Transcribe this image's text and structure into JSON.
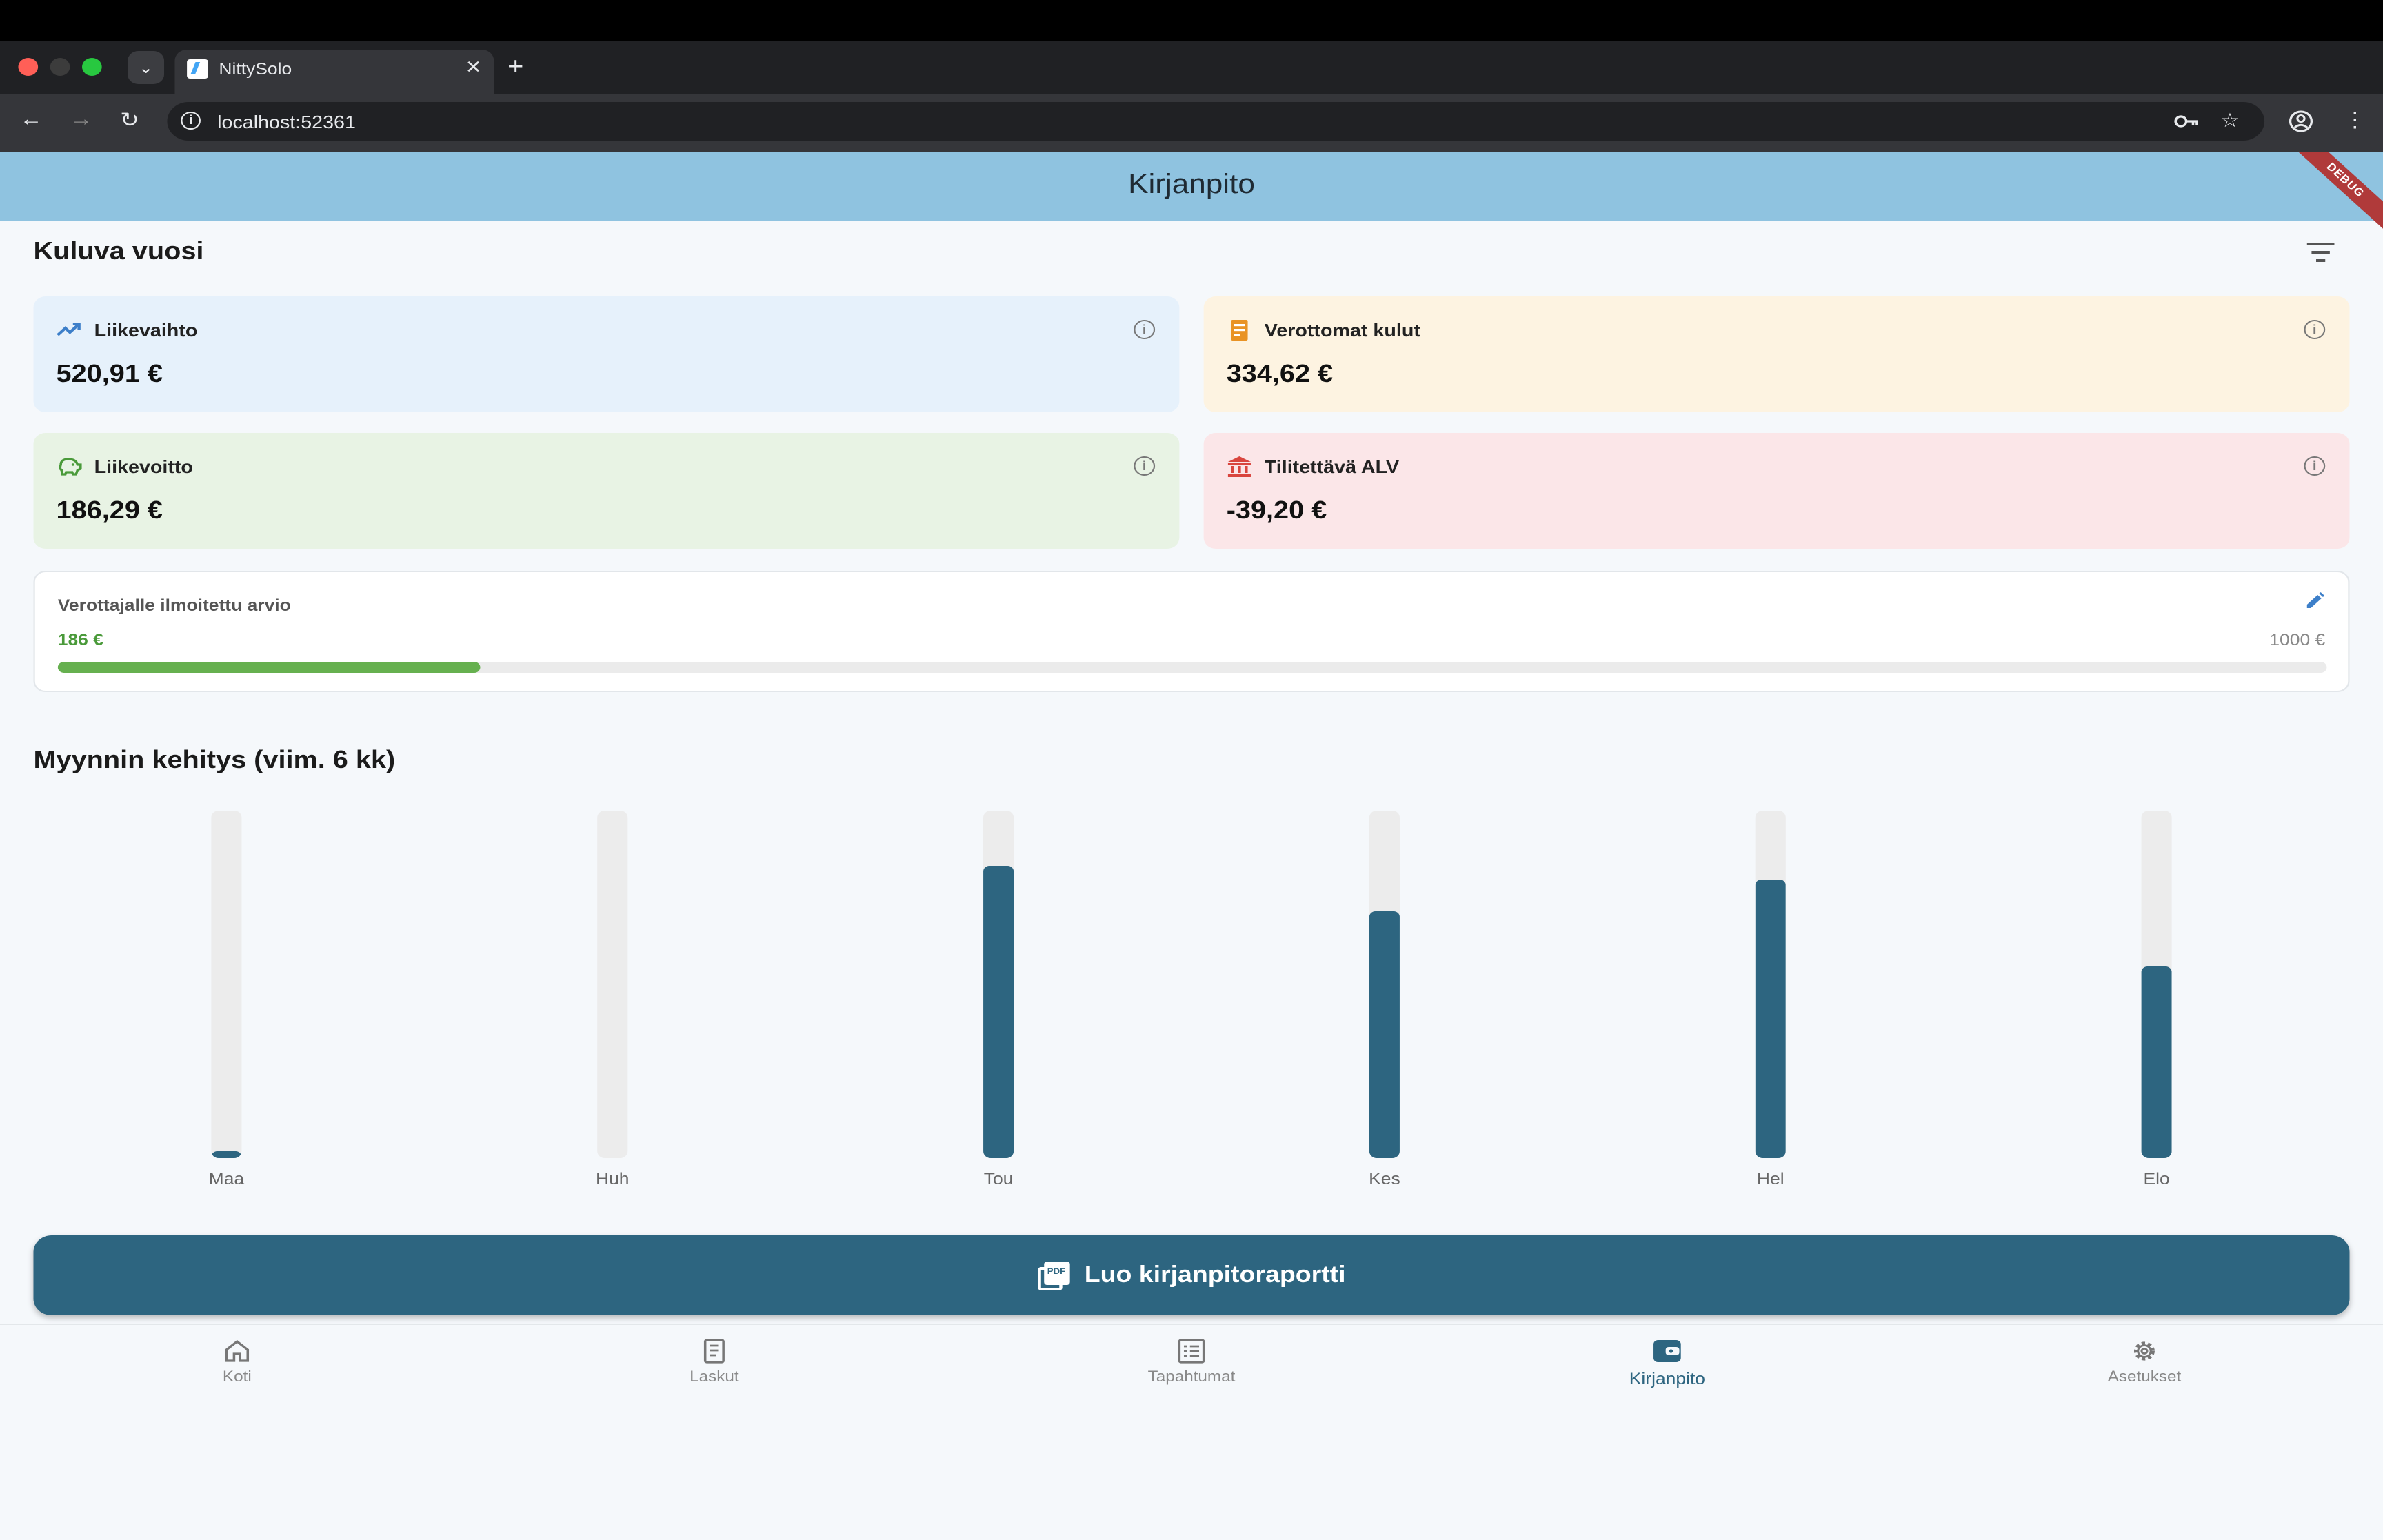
{
  "browser": {
    "tab_title": "NittySolo",
    "tab_close": "✕",
    "new_tab": "+",
    "tab_search": "⌄",
    "url": "localhost:52361"
  },
  "app": {
    "title": "Kirjanpito",
    "debug_label": "DEBUG",
    "section_title": "Kuluva vuosi",
    "cards": [
      {
        "label": "Liikevaihto",
        "value": "520,91 €",
        "bg": "#e6f1fb",
        "icon": "trending-up-icon",
        "icon_color": "#3d7fc9"
      },
      {
        "label": "Verottomat kulut",
        "value": "334,62 €",
        "bg": "#fdf3e1",
        "icon": "receipt-icon",
        "icon_color": "#e99324"
      },
      {
        "label": "Liikevoitto",
        "value": "186,29 €",
        "bg": "#e8f3e4",
        "icon": "piggy-bank-icon",
        "icon_color": "#4a9a3a"
      },
      {
        "label": "Tilitettävä ALV",
        "value": "-39,20 €",
        "bg": "#fbe6e8",
        "icon": "bank-icon",
        "icon_color": "#d9453e"
      }
    ],
    "estimate": {
      "label": "Verottajalle ilmoitettu arvio",
      "current": "186 €",
      "max": "1000 €",
      "progress": 0.186
    },
    "chart_title": "Myynnin kehitys (viim. 6 kk)",
    "chart_data": {
      "type": "bar",
      "categories": [
        "Maa",
        "Huh",
        "Tou",
        "Kes",
        "Hel",
        "Elo"
      ],
      "values": [
        0.02,
        0.0,
        0.84,
        0.71,
        0.8,
        0.55
      ],
      "ylim": [
        0,
        1
      ],
      "bar_color": "#2d6580",
      "track_color": "#ececec"
    },
    "report_button": "Luo kirjanpitoraportti",
    "pdf_icon_text": "PDF",
    "nav": [
      {
        "label": "Koti",
        "icon": "home-icon",
        "active": false
      },
      {
        "label": "Laskut",
        "icon": "receipt-icon",
        "active": false
      },
      {
        "label": "Tapahtumat",
        "icon": "list-icon",
        "active": false
      },
      {
        "label": "Kirjanpito",
        "icon": "wallet-icon",
        "active": true
      },
      {
        "label": "Asetukset",
        "icon": "gear-icon",
        "active": false
      }
    ]
  }
}
